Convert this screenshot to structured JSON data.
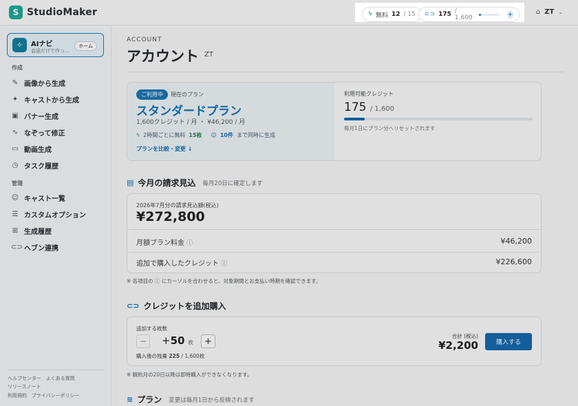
{
  "app": {
    "name": "StudioMaker",
    "logo_letter": "S"
  },
  "header": {
    "free": {
      "label": "無料",
      "used": "12",
      "total": "/ 15"
    },
    "credits": {
      "current": "175",
      "total": "/ 1,600",
      "fill_fraction": 0.11
    },
    "user": "ZT"
  },
  "sidebar": {
    "ai": {
      "title": "AIナビ",
      "subtitle": "会話だけで作っ…",
      "home": "ホーム"
    },
    "section_create": "作成",
    "create_items": [
      {
        "label": "画像から生成",
        "icon": "brush-icon"
      },
      {
        "label": "キャストから生成",
        "icon": "sparkle-icon"
      },
      {
        "label": "バナー生成",
        "icon": "image-icon"
      },
      {
        "label": "なぞって修正",
        "icon": "trace-icon"
      },
      {
        "label": "動画生成",
        "icon": "video-icon"
      },
      {
        "label": "タスク履歴",
        "icon": "clock-icon"
      }
    ],
    "section_manage": "管理",
    "manage_items": [
      {
        "label": "キャスト一覧",
        "icon": "users-icon"
      },
      {
        "label": "カスタムオプション",
        "icon": "sliders-icon"
      },
      {
        "label": "生成履歴",
        "icon": "grid-icon"
      },
      {
        "label": "ヘブン連携",
        "icon": "link-icon"
      }
    ],
    "footer": {
      "help": "ヘルプセンター",
      "faq": "よくある質問",
      "release": "リリースノート",
      "terms": "利用規約",
      "privacy": "プライバシーポリシー"
    }
  },
  "page": {
    "eyebrow": "ACCOUNT",
    "title": "アカウント",
    "user": "ZT"
  },
  "plan": {
    "badge": "ご利用中",
    "current_label": "現在のプラン",
    "name": "スタンダードプラン",
    "desc": "1,600クレジット / 月 ・ ¥46,200 / 月",
    "feature1_pre": "2時間ごとに無料",
    "feature1_val": "15枚",
    "feature2_val": "10件",
    "feature2_post": "まで同時に生成",
    "compare_link": "プランを比較・変更 ↓",
    "credits_label": "利用可能クレジット",
    "credits_current": "175",
    "credits_total": "/ 1,600",
    "credits_fill_fraction": 0.11,
    "reset_note": "毎月1日にプラン分へリセットされます"
  },
  "billing": {
    "heading": "今月の請求見込",
    "sub": "毎月20日に確定します",
    "estimate_label": "2026年7月分の請求見込額(税込)",
    "estimate": "¥272,800",
    "rows": [
      {
        "label": "月額プラン料金",
        "value": "¥46,200"
      },
      {
        "label": "追加で購入したクレジット",
        "value": "¥226,600"
      }
    ],
    "note": "※ 各項目の ⓘ にカーソルを合わせると、対象期間とお支払い時期を確認できます。"
  },
  "purchase": {
    "heading": "クレジットを追加購入",
    "qty_label": "追加する枚数",
    "qty_sign": "+",
    "qty": "50",
    "qty_unit": "枚",
    "after_pre": "購入後の残量",
    "after_val": "225",
    "after_total": "/ 1,600枚",
    "total_label": "合計 (税込)",
    "total": "¥2,200",
    "buy": "購入する",
    "note": "※ 解約月の20日以降は即時購入ができなくなります。"
  },
  "plans_section": {
    "heading": "プラン",
    "sub": "変更は毎月1日から反映されます"
  }
}
